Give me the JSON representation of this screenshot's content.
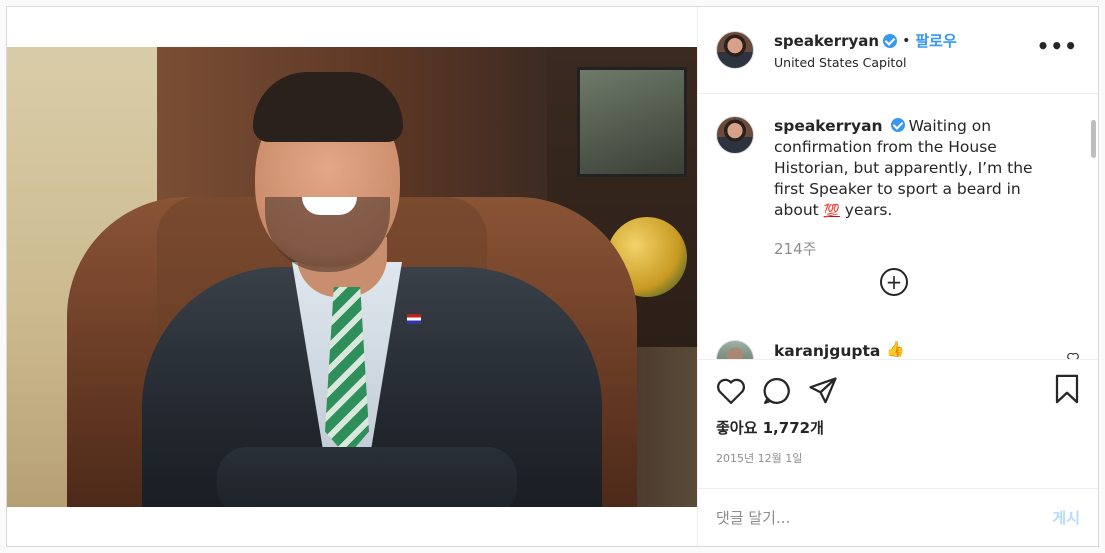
{
  "header": {
    "username": "speakerryan",
    "dot": "•",
    "follow_label": "팔로우",
    "location": "United States Capitol",
    "more_label": "•••"
  },
  "caption": {
    "username": "speakerryan",
    "text_before": "Waiting on confirmation from the House Historian, but apparently, I’m the first Speaker to sport a beard in about ",
    "emoji": "💯",
    "text_after": " years.",
    "time_ago": "214주"
  },
  "load_more_label": "+",
  "comment": {
    "username": "karanjgupta",
    "emoji": "👍"
  },
  "likes_text": "좋아요 1,772개",
  "date_text": "2015년 12월 1일",
  "add_comment": {
    "placeholder": "댓글 달기...",
    "post_label": "게시"
  },
  "colors": {
    "accent": "#3897f0",
    "post_button_disabled": "#b3dbff",
    "text": "#262626",
    "muted": "#8e8e8e"
  },
  "icons": [
    "verified-badge-icon",
    "more-options-icon",
    "load-more-comments-icon",
    "heart-icon",
    "comment-icon",
    "share-icon",
    "bookmark-icon",
    "comment-like-icon"
  ]
}
